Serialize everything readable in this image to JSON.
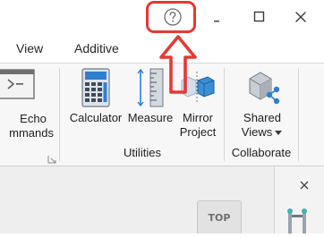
{
  "tabs": [
    {
      "label": "View"
    },
    {
      "label": "Additive"
    }
  ],
  "ribbon": {
    "echo": {
      "label_line1": "Echo",
      "label_line2": "mmands"
    },
    "utilities": {
      "calculator": "Calculator",
      "measure": "Measure",
      "mirror_line1": "Mirror",
      "mirror_line2": "Project",
      "group_label": "Utilities"
    },
    "collaborate": {
      "shared_line1": "Shared",
      "shared_line2": "Views",
      "group_label": "Collaborate"
    }
  },
  "viewcube": {
    "face_label": "TOP"
  },
  "icons": {
    "help": "help-icon",
    "minimize": "minimize-icon",
    "maximize": "maximize-icon",
    "close": "close-icon"
  },
  "colors": {
    "highlight": "#e53935",
    "ribbon_bg": "#f7f7f7",
    "accent_blue": "#2f7fd0"
  }
}
